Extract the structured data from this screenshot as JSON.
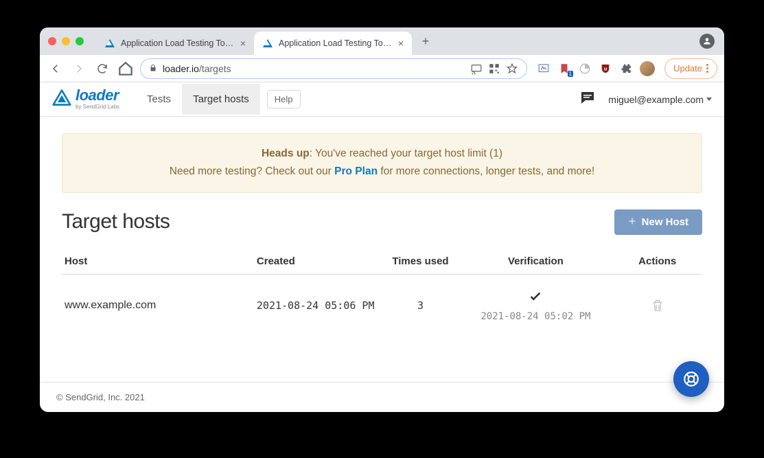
{
  "browser": {
    "tabs": [
      {
        "title": "Application Load Testing Tools"
      },
      {
        "title": "Application Load Testing Tools"
      }
    ],
    "url_host": "loader.io",
    "url_path": "/targets",
    "update_label": "Update"
  },
  "nav": {
    "brand": "loader",
    "byline": "by SendGrid Labs",
    "items": {
      "tests": "Tests",
      "targets": "Target hosts"
    },
    "help": "Help",
    "user": "miguel@example.com"
  },
  "alert": {
    "heads_up": "Heads up",
    "line1_rest": ": You've reached your target host limit (1)",
    "line2_pre": "Need more testing? Check out our ",
    "plan_link": "Pro Plan",
    "line2_post": " for more connections, longer tests, and more!"
  },
  "page": {
    "title": "Target hosts",
    "new_host": "New Host"
  },
  "table": {
    "headers": {
      "host": "Host",
      "created": "Created",
      "times": "Times used",
      "verif": "Verification",
      "actions": "Actions"
    },
    "rows": [
      {
        "host": "www.example.com",
        "created": "2021-08-24 05:06 PM",
        "times": "3",
        "verified_at": "2021-08-24 05:02 PM"
      }
    ]
  },
  "footer": {
    "copyright": "© SendGrid, Inc. 2021"
  }
}
